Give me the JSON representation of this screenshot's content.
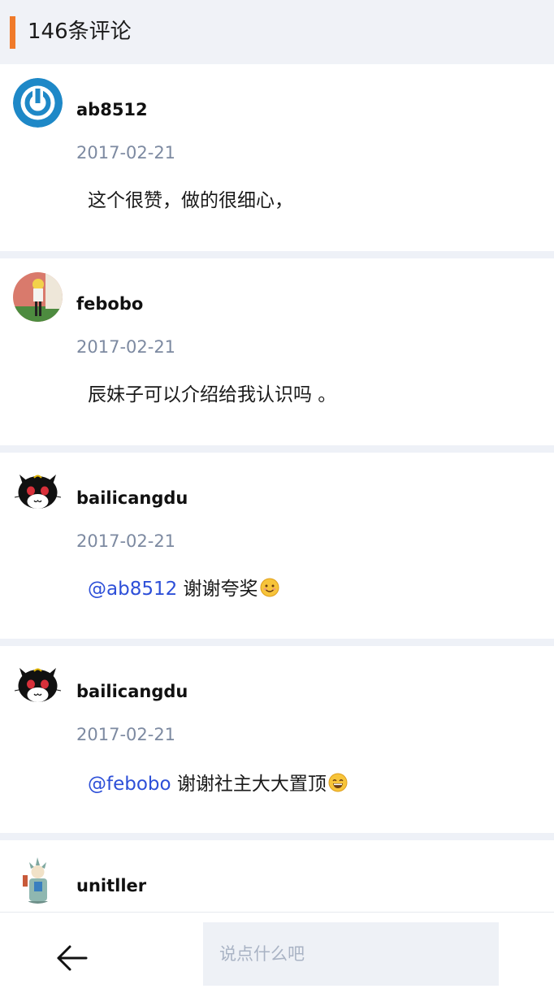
{
  "header": {
    "title": "146条评论"
  },
  "comments": [
    {
      "username": "ab8512",
      "date": "2017-02-21",
      "mention": "",
      "text": "这个很赞，做的很细心，",
      "avatar": "power-logo-avatar",
      "emoji": ""
    },
    {
      "username": "febobo",
      "date": "2017-02-21",
      "mention": "",
      "text": "辰妹子可以介绍给我认识吗 。",
      "avatar": "photo-avatar",
      "emoji": ""
    },
    {
      "username": "bailicangdu",
      "date": "2017-02-21",
      "mention": "@ab8512",
      "text": "谢谢夸奖",
      "avatar": "black-cat-avatar",
      "emoji": "smile-emoji"
    },
    {
      "username": "bailicangdu",
      "date": "2017-02-21",
      "mention": "@febobo",
      "text": "谢谢社主大大置顶",
      "avatar": "black-cat-avatar",
      "emoji": "grin-emoji"
    },
    {
      "username": "unitller",
      "date": "",
      "mention": "",
      "text": "",
      "avatar": "statue-avatar",
      "emoji": ""
    }
  ],
  "bottom_bar": {
    "back_icon": "back-arrow-icon",
    "input_placeholder": "说点什么吧"
  },
  "colors": {
    "accent": "#f07a2a",
    "mention": "#2d4fd8",
    "date": "#7d8aa1",
    "separator": "#eef1f7"
  }
}
